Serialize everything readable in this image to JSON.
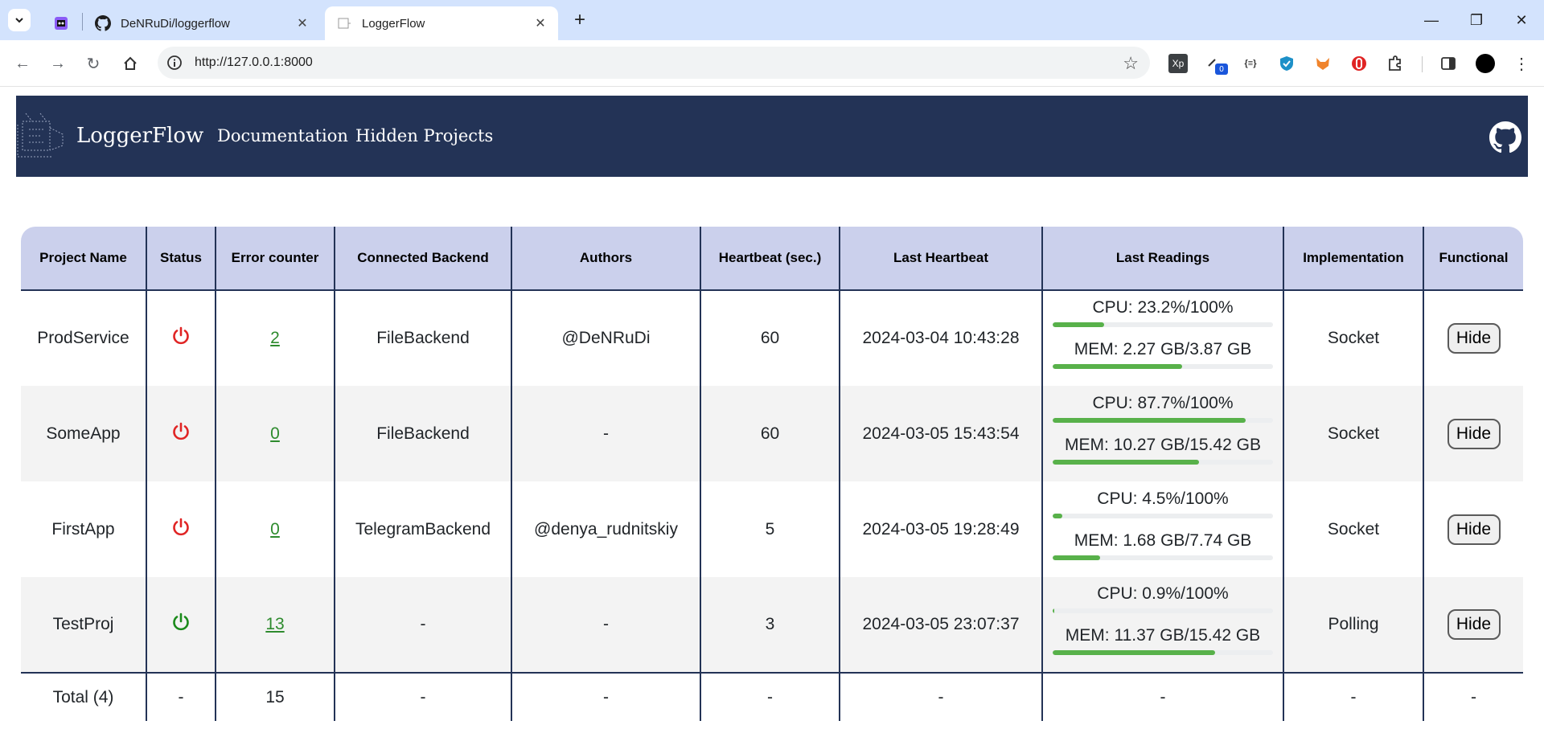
{
  "browser": {
    "tabs": [
      {
        "title": "DeNRuDi/loggerflow"
      },
      {
        "title": "LoggerFlow"
      }
    ],
    "url": "http://127.0.0.1:8000",
    "extension_badge": "0",
    "ext_xp": "Xp",
    "ext_json": "{≡}"
  },
  "header": {
    "brand": "LoggerFlow",
    "nav": [
      "Documentation",
      "Hidden Projects"
    ]
  },
  "table": {
    "columns": [
      "Project Name",
      "Status",
      "Error counter",
      "Connected Backend",
      "Authors",
      "Heartbeat (sec.)",
      "Last Heartbeat",
      "Last Readings",
      "Implementation",
      "Functional"
    ],
    "rows": [
      {
        "name": "ProdService",
        "status": "offline",
        "errors": "2",
        "backend": "FileBackend",
        "authors": "@DeNRuDi",
        "heartbeat": "60",
        "last_heartbeat": "2024-03-04 10:43:28",
        "cpu_text": "CPU: 23.2%/100%",
        "cpu_pct": 23.2,
        "mem_text": "MEM: 2.27 GB/3.87 GB",
        "mem_pct": 58.7,
        "implementation": "Socket",
        "action": "Hide"
      },
      {
        "name": "SomeApp",
        "status": "offline",
        "errors": "0",
        "backend": "FileBackend",
        "authors": "-",
        "heartbeat": "60",
        "last_heartbeat": "2024-03-05 15:43:54",
        "cpu_text": "CPU: 87.7%/100%",
        "cpu_pct": 87.7,
        "mem_text": "MEM: 10.27 GB/15.42 GB",
        "mem_pct": 66.6,
        "implementation": "Socket",
        "action": "Hide"
      },
      {
        "name": "FirstApp",
        "status": "offline",
        "errors": "0",
        "backend": "TelegramBackend",
        "authors": "@denya_rudnitskiy",
        "heartbeat": "5",
        "last_heartbeat": "2024-03-05 19:28:49",
        "cpu_text": "CPU: 4.5%/100%",
        "cpu_pct": 4.5,
        "mem_text": "MEM: 1.68 GB/7.74 GB",
        "mem_pct": 21.7,
        "implementation": "Socket",
        "action": "Hide"
      },
      {
        "name": "TestProj",
        "status": "online",
        "errors": "13",
        "backend": "-",
        "authors": "-",
        "heartbeat": "3",
        "last_heartbeat": "2024-03-05 23:07:37",
        "cpu_text": "CPU: 0.9%/100%",
        "cpu_pct": 0.9,
        "mem_text": "MEM: 11.37 GB/15.42 GB",
        "mem_pct": 73.7,
        "implementation": "Polling",
        "action": "Hide"
      }
    ],
    "total": {
      "name": "Total (4)",
      "status": "-",
      "errors": "15",
      "backend": "-",
      "authors": "-",
      "heartbeat": "-",
      "last_heartbeat": "-",
      "readings": "-",
      "implementation": "-",
      "functional": "-"
    }
  },
  "colors": {
    "header_bg": "#233356",
    "table_head_bg": "#cbd0ec",
    "status_offline": "#e02424",
    "status_online": "#1a8a1a",
    "bar_fill": "#58b14a"
  }
}
